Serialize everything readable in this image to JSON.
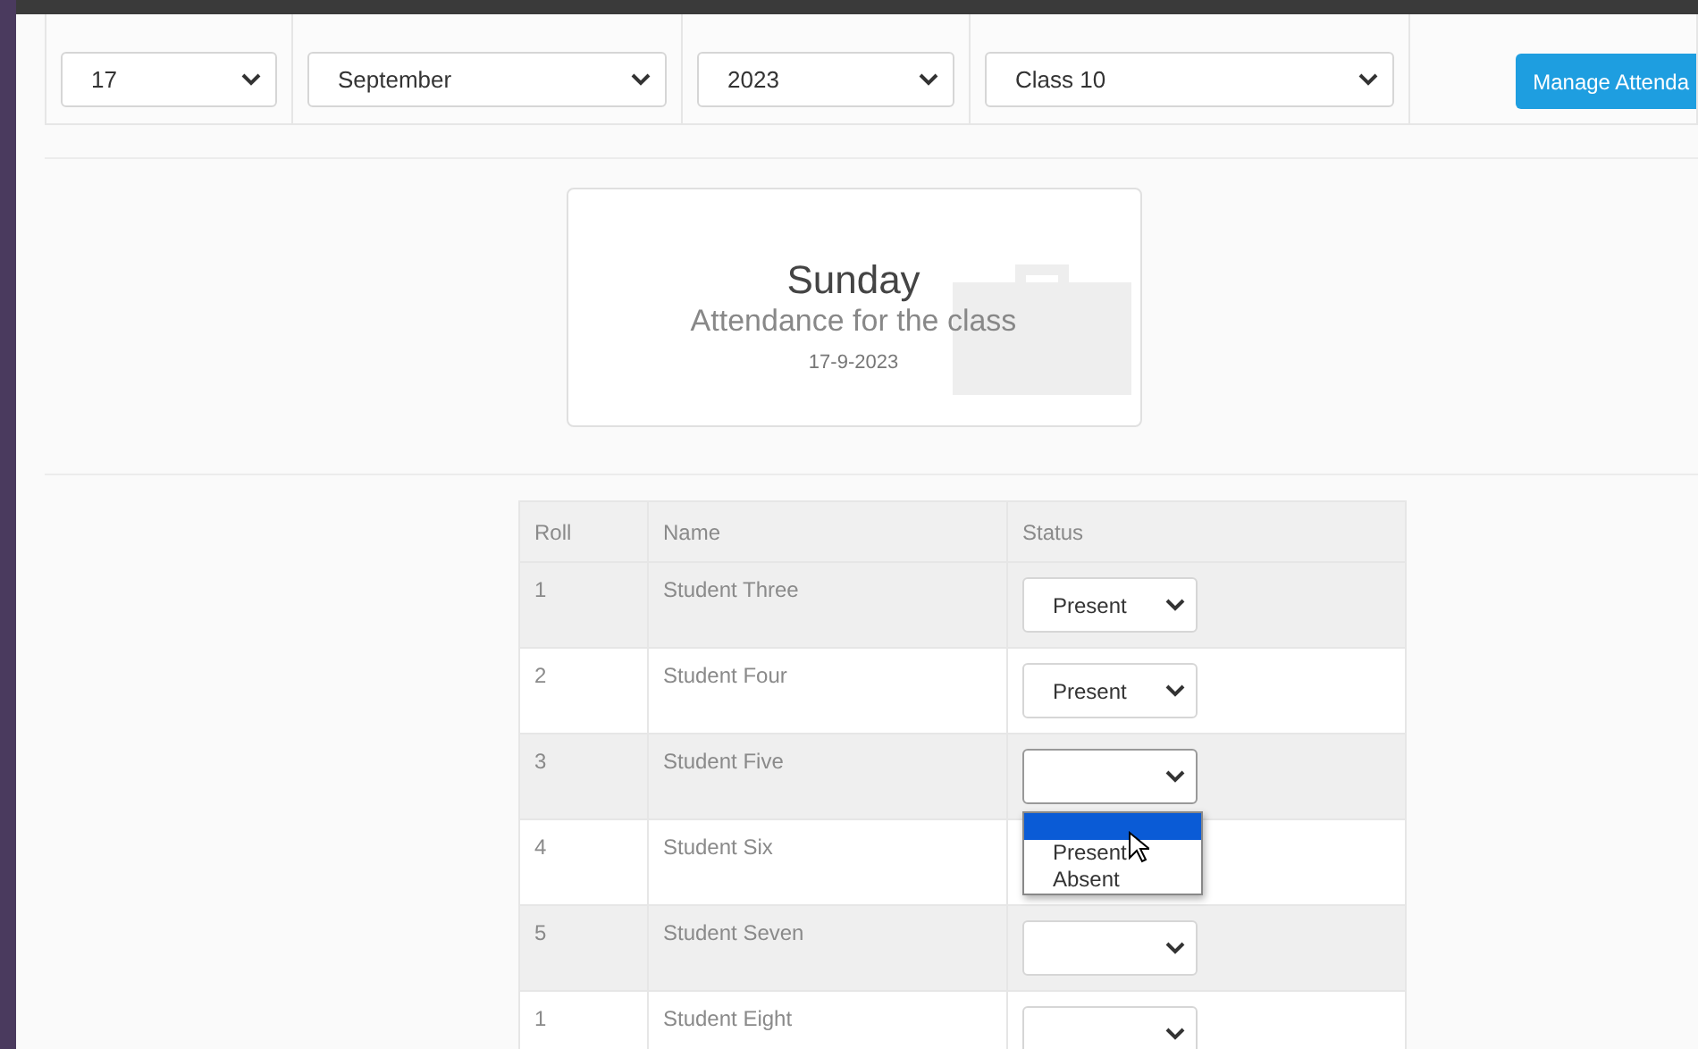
{
  "filters": [
    {
      "value": "17"
    },
    {
      "value": "September"
    },
    {
      "value": "2023"
    },
    {
      "value": "Class 10"
    }
  ],
  "manage_button": {
    "label": "Manage Attenda"
  },
  "day_card": {
    "day": "Sunday",
    "subtitle": "Attendance for the class",
    "date": "17-9-2023"
  },
  "table": {
    "columns": [
      "Roll",
      "Name",
      "Status"
    ],
    "rows": [
      {
        "roll": "1",
        "name": "Student Three",
        "status": "Present",
        "expanded": false
      },
      {
        "roll": "2",
        "name": "Student Four",
        "status": "Present",
        "expanded": false
      },
      {
        "roll": "3",
        "name": "Student Five",
        "status": "",
        "expanded": true,
        "options": [
          {
            "selected": true
          },
          {
            "label": "Present",
            "selected": false
          },
          {
            "label": "Absent",
            "selected": false
          }
        ]
      },
      {
        "roll": "4",
        "name": "Student Six",
        "status": "",
        "expanded": false
      },
      {
        "roll": "5",
        "name": "Student Seven",
        "status": "",
        "expanded": false
      },
      {
        "roll": "1",
        "name": "Student Eight",
        "status": "",
        "expanded": false
      }
    ]
  }
}
